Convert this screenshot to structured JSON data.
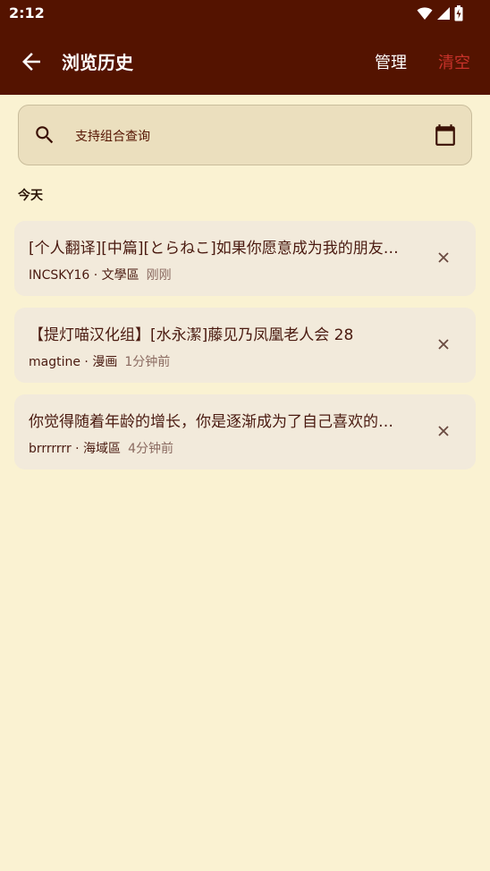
{
  "status_bar": {
    "time": "2:12"
  },
  "app_bar": {
    "title": "浏览历史",
    "manage": "管理",
    "clear": "清空"
  },
  "search": {
    "placeholder": "支持组合查询"
  },
  "section": {
    "label": "今天"
  },
  "items": [
    {
      "title": "[个人翻译][中篇][とらねこ]如果你愿意成为我的朋友…",
      "meta": "INCSKY16 · 文學區",
      "time": "刚刚"
    },
    {
      "title": "【提灯喵汉化组】[水永潔]藤见乃凤凰老人会 28",
      "meta": "magtine · 漫画",
      "time": "1分钟前"
    },
    {
      "title": "你觉得随着年龄的增长，你是逐渐成为了自己喜欢的…",
      "meta": "brrrrrrr · 海域區",
      "time": "4分钟前"
    }
  ],
  "colors": {
    "bar": "#541300",
    "background": "#faf2d2",
    "card": "#f2eadb",
    "accent_red": "#c8322a"
  }
}
